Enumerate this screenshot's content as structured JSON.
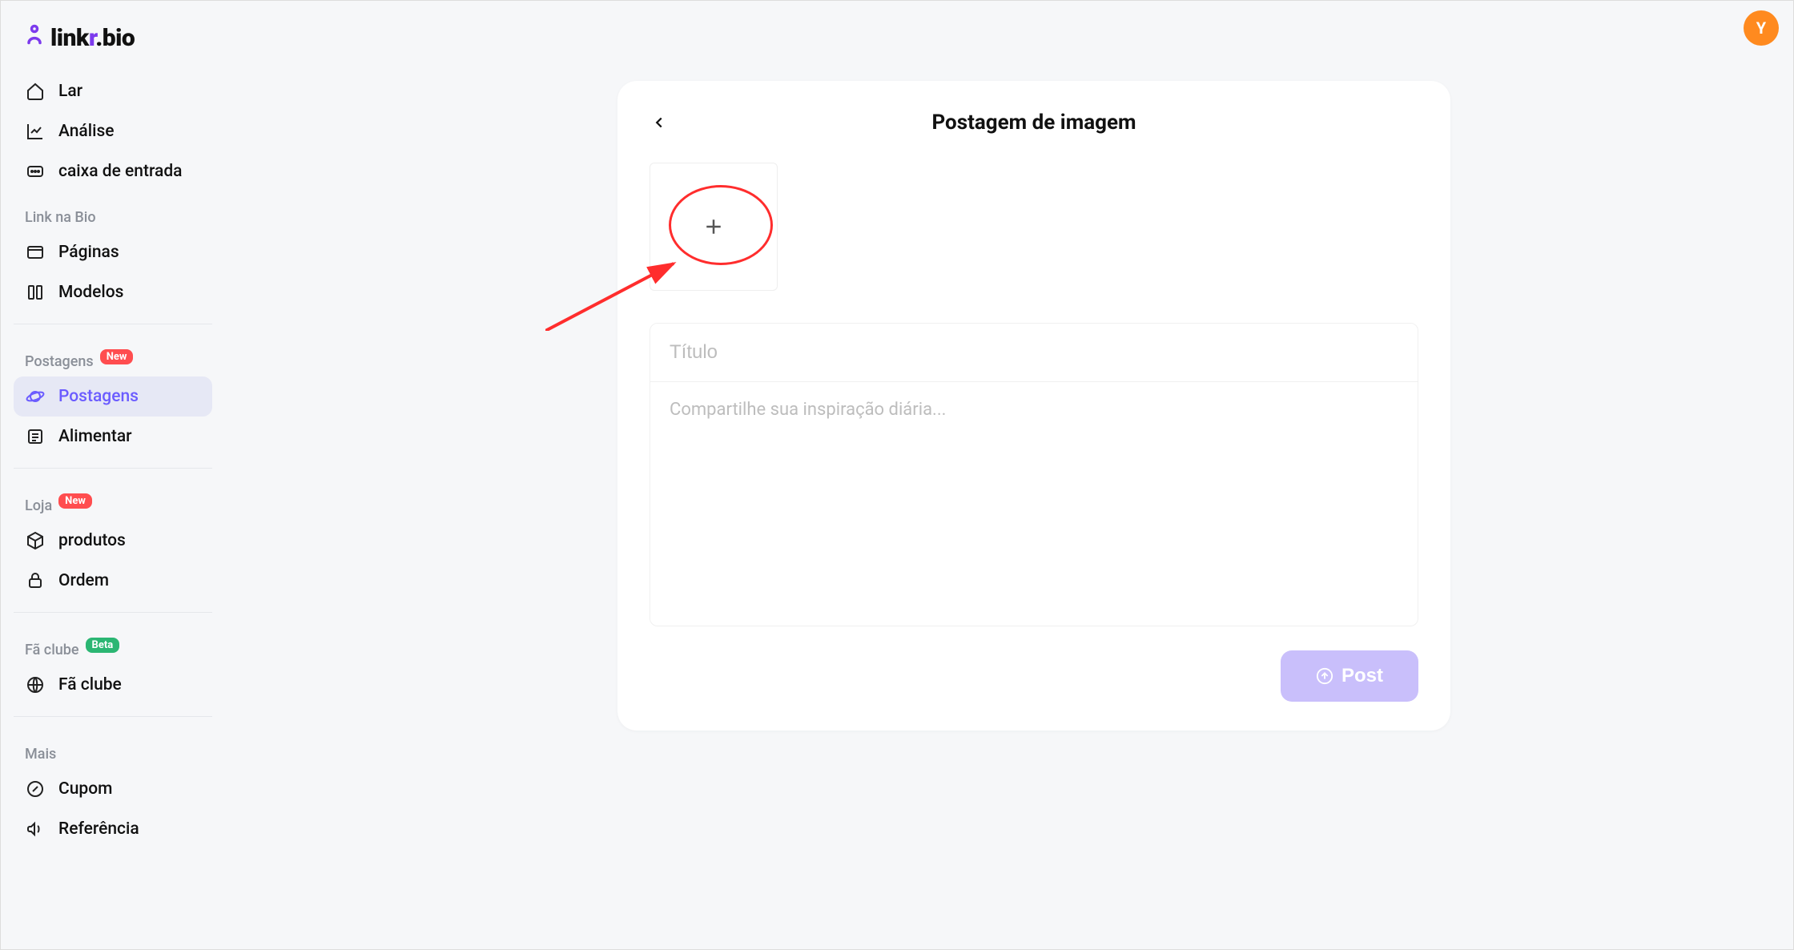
{
  "brand": {
    "part1": "link",
    "part2": "r",
    "part3": ".bio"
  },
  "avatar": {
    "initial": "Y"
  },
  "sidebar": {
    "top": [
      {
        "label": "Lar",
        "icon": "home"
      },
      {
        "label": "Análise",
        "icon": "chart"
      },
      {
        "label": "caixa de entrada",
        "icon": "inbox"
      }
    ],
    "sections": [
      {
        "title": "Link na Bio",
        "badge": null,
        "items": [
          {
            "label": "Páginas",
            "icon": "pages"
          },
          {
            "label": "Modelos",
            "icon": "templates"
          }
        ]
      },
      {
        "title": "Postagens",
        "badge": "New",
        "badgeClass": "badge-new",
        "items": [
          {
            "label": "Postagens",
            "icon": "planet",
            "active": true
          },
          {
            "label": "Alimentar",
            "icon": "feed"
          }
        ]
      },
      {
        "title": "Loja",
        "badge": "New",
        "badgeClass": "badge-new",
        "items": [
          {
            "label": "produtos",
            "icon": "box"
          },
          {
            "label": "Ordem",
            "icon": "lock"
          }
        ]
      },
      {
        "title": "Fã clube",
        "badge": "Beta",
        "badgeClass": "badge-beta",
        "items": [
          {
            "label": "Fã clube",
            "icon": "globe"
          }
        ]
      },
      {
        "title": "Mais",
        "badge": null,
        "items": [
          {
            "label": "Cupom",
            "icon": "coupon"
          },
          {
            "label": "Referência",
            "icon": "megaphone"
          }
        ]
      }
    ]
  },
  "card": {
    "title": "Postagem de imagem",
    "titlePlaceholder": "Título",
    "bodyPlaceholder": "Compartilhe sua inspiração diária...",
    "postLabel": "Post"
  }
}
